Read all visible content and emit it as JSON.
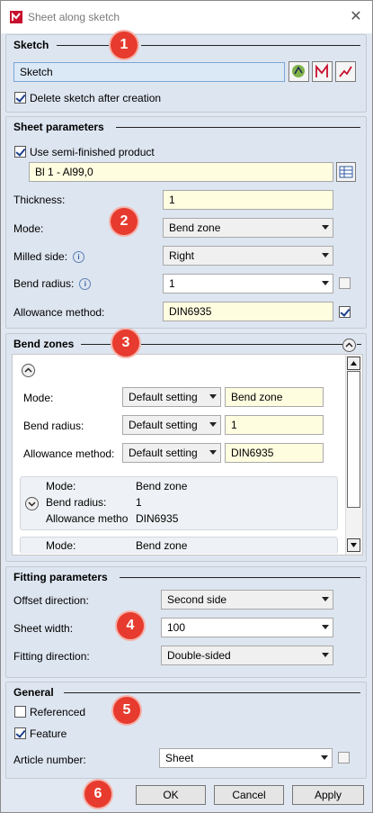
{
  "window": {
    "title": "Sheet along sketch",
    "close_glyph": "✕",
    "app_icon": "sheetmetal-app-icon"
  },
  "badges": [
    "1",
    "2",
    "3",
    "4",
    "5",
    "6"
  ],
  "sketch": {
    "header": "Sketch",
    "value": "Sketch",
    "delete_label": "Delete sketch after creation",
    "delete_checked": true
  },
  "sheet_parameters": {
    "header": "Sheet parameters",
    "semi_label": "Use semi-finished product",
    "semi_checked": true,
    "semi_value": "Bl 1 - Al99,0",
    "thickness_label": "Thickness:",
    "thickness_value": "1",
    "mode_label": "Mode:",
    "mode_value": "Bend zone",
    "milled_label": "Milled side:",
    "milled_value": "Right",
    "bend_radius_label": "Bend radius:",
    "bend_radius_value": "1",
    "allowance_label": "Allowance method:",
    "allowance_value": "DIN6935"
  },
  "bend_zones": {
    "header": "Bend zones",
    "expanded": {
      "mode_label": "Mode:",
      "mode_setting": "Default setting",
      "mode_value": "Bend zone",
      "radius_label": "Bend radius:",
      "radius_setting": "Default setting",
      "radius_value": "1",
      "allowance_label": "Allowance method:",
      "allowance_setting": "Default setting",
      "allowance_value": "DIN6935"
    },
    "collapsed": [
      {
        "mode_label": "Mode:",
        "mode_value": "Bend zone",
        "radius_label": "Bend radius:",
        "radius_value": "1",
        "allowance_label": "Allowance metho",
        "allowance_value": "DIN6935"
      },
      {
        "mode_label": "Mode:",
        "mode_value": "Bend zone"
      }
    ]
  },
  "fitting": {
    "header": "Fitting parameters",
    "offset_label": "Offset direction:",
    "offset_value": "Second side",
    "width_label": "Sheet width:",
    "width_value": "100",
    "direction_label": "Fitting direction:",
    "direction_value": "Double-sided"
  },
  "general": {
    "header": "General",
    "referenced_label": "Referenced",
    "referenced_checked": false,
    "feature_label": "Feature",
    "feature_checked": true,
    "article_label": "Article number:",
    "article_value": "Sheet"
  },
  "buttons": {
    "ok": "OK",
    "cancel": "Cancel",
    "apply": "Apply"
  }
}
